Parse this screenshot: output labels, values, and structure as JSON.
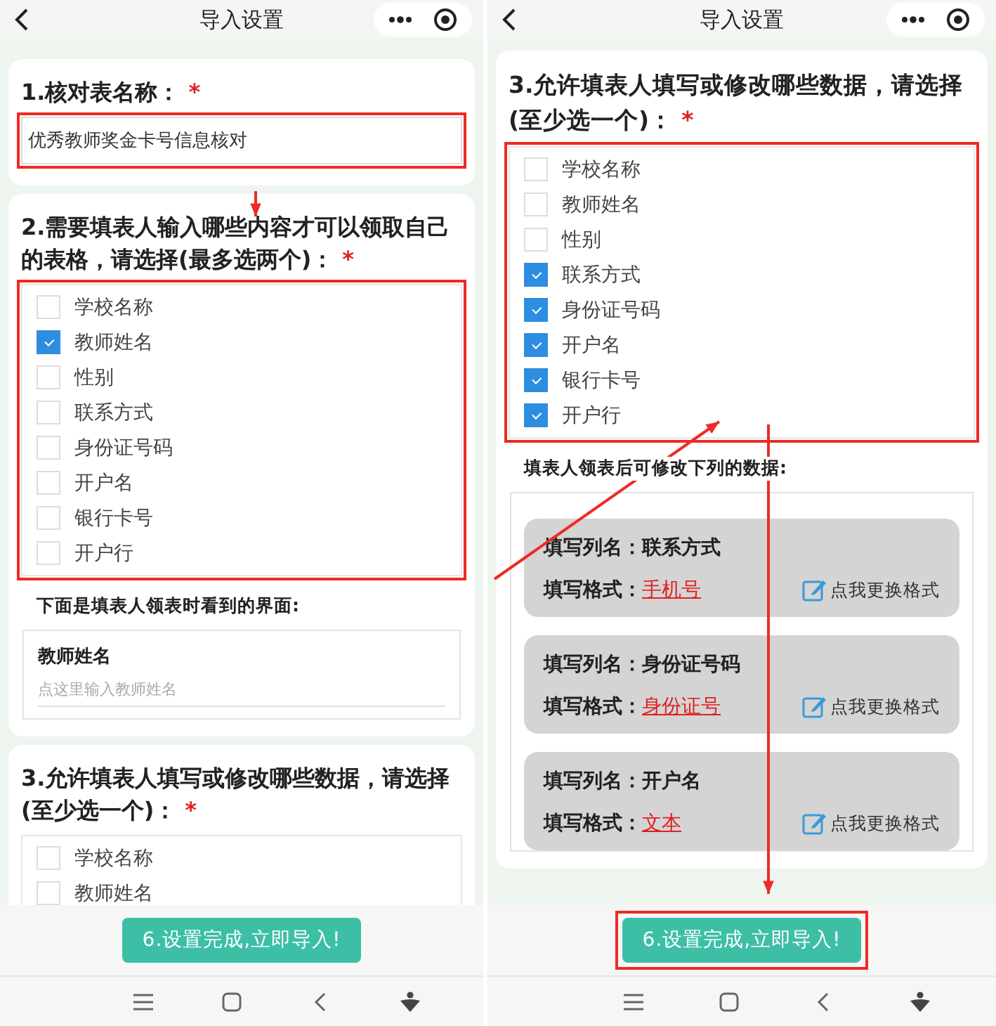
{
  "screens": [
    {
      "header": {
        "title": "导入设置"
      },
      "sections": [
        {
          "kind": "text_input",
          "title": "1.核对表名称：",
          "required": "*",
          "value": "优秀教师奖金卡号信息核对",
          "highlighted": true
        },
        {
          "kind": "checklist",
          "title": "2.需要填表人输入哪些内容才可以领取自己的表格，请选择(最多选两个)：",
          "required": "*",
          "highlighted": true,
          "options": [
            {
              "label": "学校名称",
              "checked": false
            },
            {
              "label": "教师姓名",
              "checked": true
            },
            {
              "label": "性别",
              "checked": false
            },
            {
              "label": "联系方式",
              "checked": false
            },
            {
              "label": "身份证号码",
              "checked": false
            },
            {
              "label": "开户名",
              "checked": false
            },
            {
              "label": "银行卡号",
              "checked": false
            },
            {
              "label": "开户行",
              "checked": false
            }
          ],
          "note": "下面是填表人领表时看到的界面:",
          "preview": {
            "kind": "field",
            "label": "教师姓名",
            "placeholder": "点这里输入教师姓名"
          }
        },
        {
          "kind": "checklist",
          "title": "3.允许填表人填写或修改哪些数据，请选择(至少选一个)：",
          "required": "*",
          "highlighted": false,
          "options": [
            {
              "label": "学校名称",
              "checked": false
            },
            {
              "label": "教师姓名",
              "checked": false
            }
          ]
        }
      ],
      "footer": {
        "button": "6.设置完成,立即导入!",
        "highlighted": false
      }
    },
    {
      "header": {
        "title": "导入设置"
      },
      "sections": [
        {
          "kind": "checklist",
          "title": "3.允许填表人填写或修改哪些数据，请选择(至少选一个)：",
          "required": "*",
          "highlighted": true,
          "options": [
            {
              "label": "学校名称",
              "checked": false
            },
            {
              "label": "教师姓名",
              "checked": false
            },
            {
              "label": "性别",
              "checked": false
            },
            {
              "label": "联系方式",
              "checked": true
            },
            {
              "label": "身份证号码",
              "checked": true
            },
            {
              "label": "开户名",
              "checked": true
            },
            {
              "label": "银行卡号",
              "checked": true
            },
            {
              "label": "开户行",
              "checked": true
            }
          ],
          "note": "填表人领表后可修改下列的数据:",
          "preview": {
            "kind": "formats",
            "items": [
              {
                "column_label": "填写列名：",
                "column": "联系方式",
                "format_label": "填写格式：",
                "format": "手机号",
                "action": "点我更换格式"
              },
              {
                "column_label": "填写列名：",
                "column": "身份证号码",
                "format_label": "填写格式：",
                "format": "身份证号",
                "action": "点我更换格式"
              },
              {
                "column_label": "填写列名：",
                "column": "开户名",
                "format_label": "填写格式：",
                "format": "文本",
                "action": "点我更换格式"
              }
            ]
          }
        }
      ],
      "footer": {
        "button": "6.设置完成,立即导入!",
        "highlighted": true
      }
    }
  ]
}
